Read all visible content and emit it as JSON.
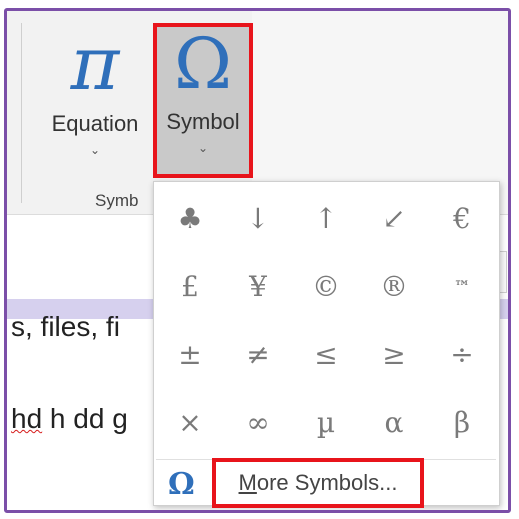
{
  "ribbon": {
    "equation_icon": "π",
    "equation_label": "Equation",
    "symbol_icon": "Ω",
    "symbol_label": "Symbol",
    "chevron": "⌄",
    "group_label": "Symb"
  },
  "document": {
    "line1": "s, files, fi",
    "line2_word1": "hd",
    "line2_rest": " h dd g"
  },
  "gallery": {
    "symbols": [
      "♣",
      "↓",
      "↑",
      "↙",
      "€",
      "£",
      "¥",
      "©",
      "®",
      "™",
      "±",
      "≠",
      "≤",
      "≥",
      "÷",
      "×",
      "∞",
      "µ",
      "α",
      "β"
    ],
    "more_icon": "Ω",
    "more_label_first": "M",
    "more_label_rest": "ore Symbols..."
  },
  "colors": {
    "accent_blue": "#2f6fba",
    "highlight_red": "#e8141b",
    "frame_purple": "#7b4fa8"
  }
}
